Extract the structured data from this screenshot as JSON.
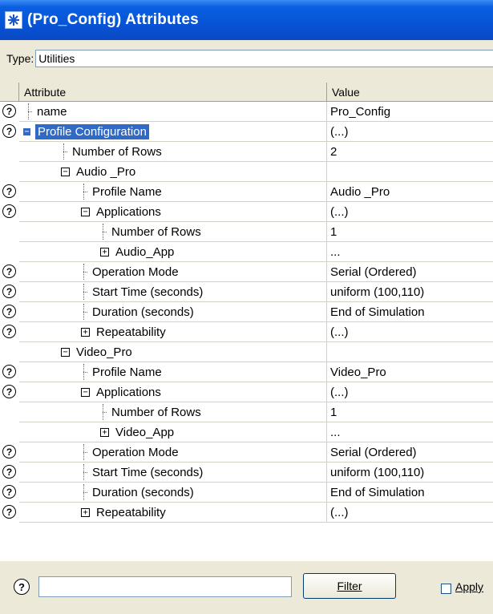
{
  "window": {
    "title": "(Pro_Config) Attributes"
  },
  "type_row": {
    "label": "Type:",
    "value": "Utilities"
  },
  "grid": {
    "col_attribute": "Attribute",
    "col_value": "Value",
    "rows": [
      {
        "attr": "name",
        "value": "Pro_Config"
      },
      {
        "attr": "Profile Configuration",
        "value": "(...)"
      },
      {
        "attr": "Number of Rows",
        "value": "2"
      },
      {
        "attr": "Audio _Pro",
        "value": ""
      },
      {
        "attr": "Profile Name",
        "value": "Audio _Pro"
      },
      {
        "attr": "Applications",
        "value": "(...)"
      },
      {
        "attr": "Number of Rows",
        "value": "1"
      },
      {
        "attr": "Audio_App",
        "value": "..."
      },
      {
        "attr": "Operation Mode",
        "value": "Serial (Ordered)"
      },
      {
        "attr": "Start Time (seconds)",
        "value": "uniform (100,110)"
      },
      {
        "attr": "Duration (seconds)",
        "value": "End of Simulation"
      },
      {
        "attr": "Repeatability",
        "value": "(...)"
      },
      {
        "attr": "Video_Pro",
        "value": ""
      },
      {
        "attr": "Profile Name",
        "value": "Video_Pro"
      },
      {
        "attr": "Applications",
        "value": "(...)"
      },
      {
        "attr": "Number of Rows",
        "value": "1"
      },
      {
        "attr": "Video_App",
        "value": "..."
      },
      {
        "attr": "Operation Mode",
        "value": "Serial (Ordered)"
      },
      {
        "attr": "Start Time (seconds)",
        "value": "uniform (100,110)"
      },
      {
        "attr": "Duration (seconds)",
        "value": "End of Simulation"
      },
      {
        "attr": "Repeatability",
        "value": "(...)"
      }
    ]
  },
  "help_glyph": "?",
  "expander": {
    "minus": "−",
    "plus": "+"
  },
  "bottom": {
    "filter_label": "Filter",
    "apply_label": "Apply"
  }
}
